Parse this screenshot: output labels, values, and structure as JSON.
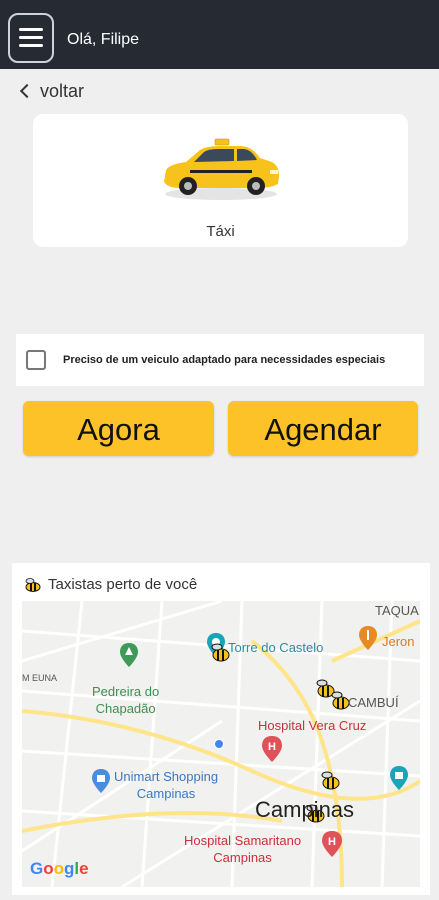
{
  "header": {
    "greeting": "Olá, Filipe",
    "menu_icon": "hamburger-menu-icon"
  },
  "nav": {
    "back_label": "voltar"
  },
  "vehicle": {
    "label": "Táxi",
    "icon": "taxi-car-icon"
  },
  "accessibility": {
    "checkbox_label": "Preciso de um veiculo adaptado para necessidades especiais",
    "checked": false
  },
  "actions": {
    "now_label": "Agora",
    "schedule_label": "Agendar"
  },
  "nearby": {
    "title": "Taxistas perto de você",
    "map": {
      "labels": {
        "taquaral": "TAQUA",
        "torre": "Torre do Castelo",
        "jeron": "Jeron",
        "pedreira": "Pedreira do\nChapadão",
        "cambui": "CAMBUÍ",
        "hospital_vera_cruz": "Hospital Vera Cruz",
        "unimart": "Unimart Shopping\nCampinas",
        "campinas": "Campinas",
        "hospital_samaritano": "Hospital Samaritano\nCampinas",
        "edge_left": "M EUNA"
      },
      "attribution": "Google"
    }
  },
  "colors": {
    "topbar": "#262b33",
    "accent": "#fdc228",
    "background": "#efefef"
  }
}
